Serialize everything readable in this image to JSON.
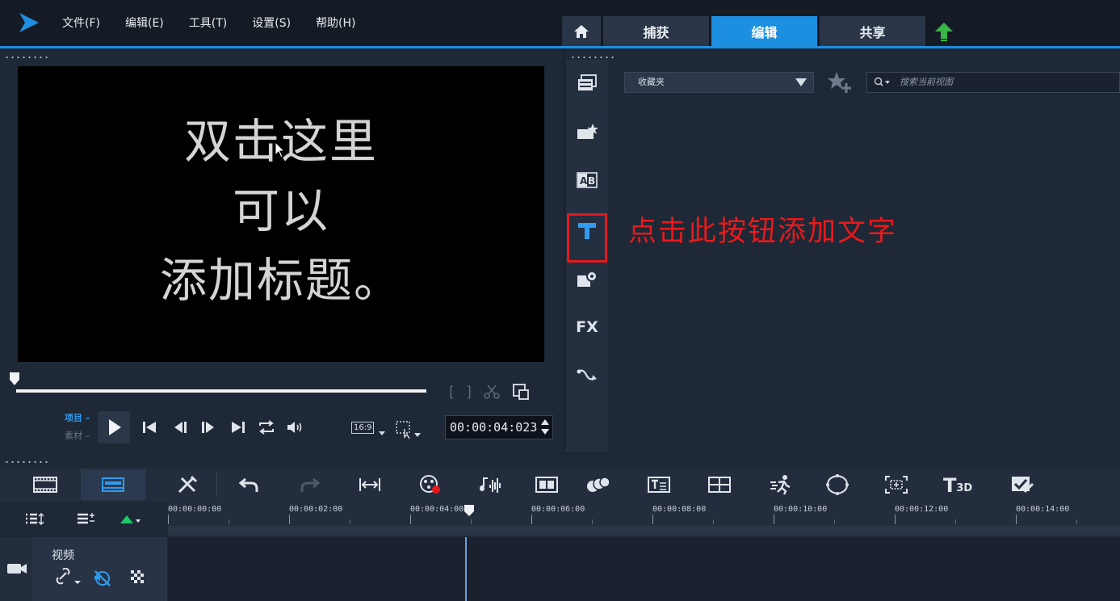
{
  "menu": {
    "items": [
      "文件(F)",
      "编辑(E)",
      "工具(T)",
      "设置(S)",
      "帮助(H)"
    ]
  },
  "mode_tabs": {
    "capture": "捕获",
    "edit": "编辑",
    "share": "共享",
    "active": "编辑"
  },
  "player": {
    "title_lines": [
      "双击这里",
      "可以",
      "添加标题。"
    ],
    "mode_project": "项目",
    "mode_clip": "素材",
    "aspect_ratio": "16:9",
    "timecode": "00:00:04:023"
  },
  "library": {
    "favorites_label": "收藏夹",
    "search_placeholder": "搜索当前视图",
    "fx_label": "FX",
    "annotation": "点击此按钮添加文字"
  },
  "timeline": {
    "ticks": [
      "00:00:00:00",
      "00:00:02:00",
      "00:00:04:00",
      "00:00:06:00",
      "00:00:08:00",
      "00:00:10:00",
      "00:00:12:00",
      "00:00:14:00"
    ],
    "track_name": "视频",
    "threed_label": "3D"
  },
  "colors": {
    "accent": "#1d8fe0",
    "annotation_red": "#e5191b",
    "upload_green": "#39b54a"
  }
}
